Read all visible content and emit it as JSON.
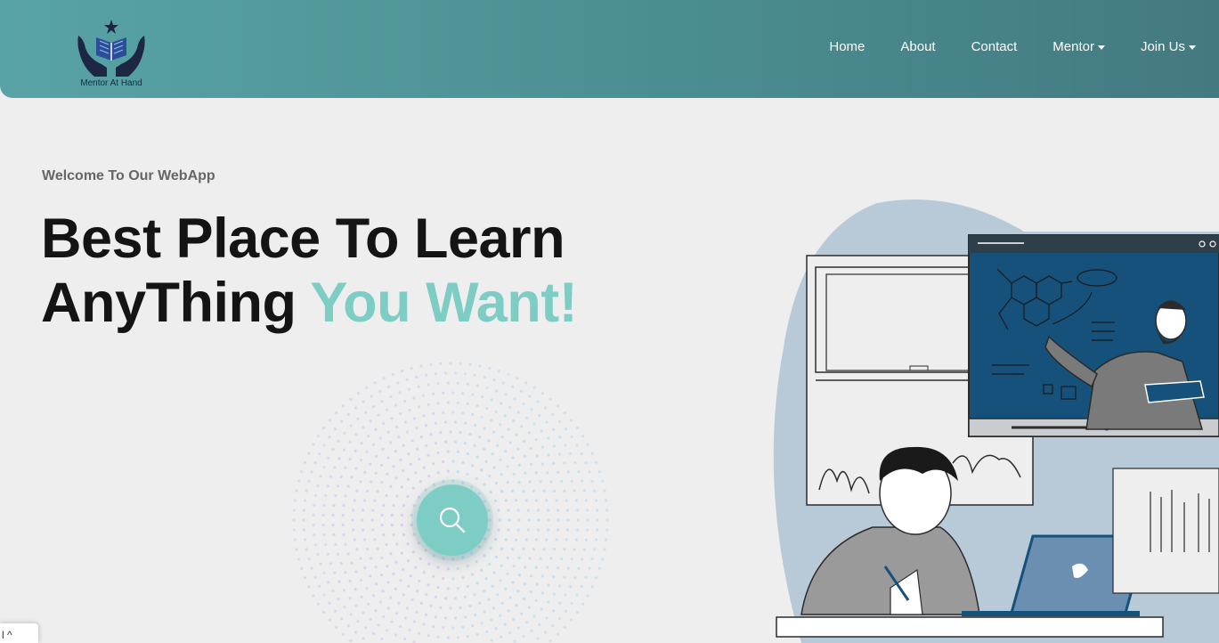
{
  "brand": {
    "name": "Mentor At Hand",
    "logo_icon": "book-hands-icon"
  },
  "nav": {
    "items": [
      {
        "label": "Home",
        "dropdown": false
      },
      {
        "label": "About",
        "dropdown": false
      },
      {
        "label": "Contact",
        "dropdown": false
      },
      {
        "label": "Mentor",
        "dropdown": true
      },
      {
        "label": "Join Us",
        "dropdown": true
      }
    ]
  },
  "hero": {
    "welcome": "Welcome To Our WebApp",
    "headline_line1": "Best Place To Learn",
    "headline_line2_plain": "AnyThing ",
    "headline_line2_accent": "You Want!",
    "search_icon": "search-icon",
    "illustration": "online-learning-illustration"
  },
  "colors": {
    "nav_start": "#58a3a6",
    "nav_end": "#437a80",
    "accent": "#7ecdc4",
    "background": "#eeeeee",
    "headline": "#141414"
  },
  "corner_widget": {
    "text": "l ^"
  }
}
